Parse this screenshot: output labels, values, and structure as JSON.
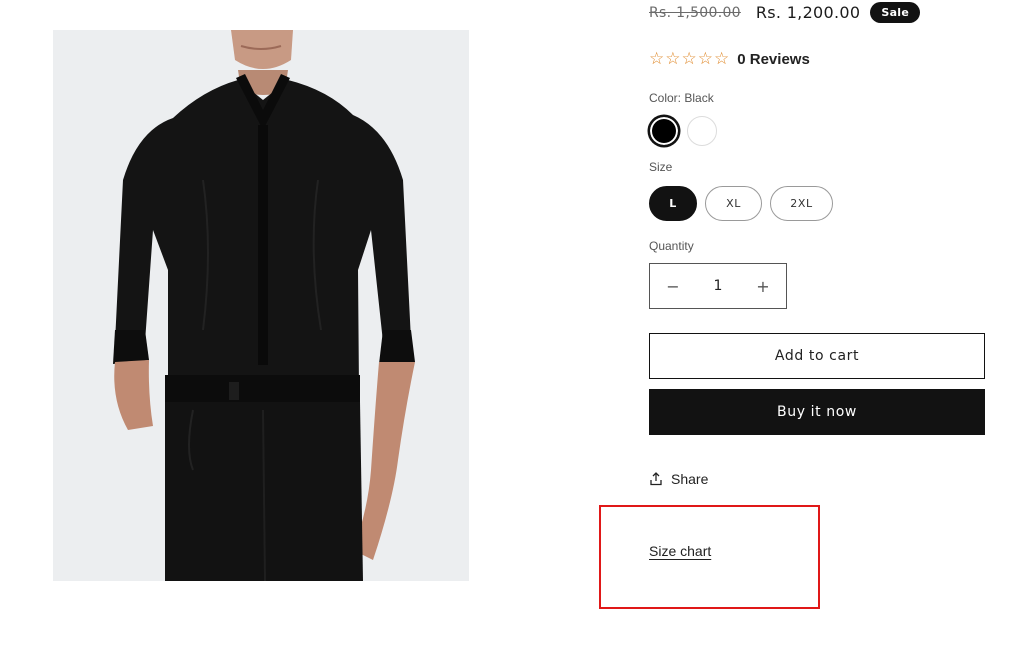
{
  "product": {
    "price_old": "Rs. 1,500.00",
    "price_new": "Rs. 1,200.00",
    "sale_badge": "Sale",
    "rating_stars": 0,
    "rating_max": 5,
    "reviews_label": "0 Reviews",
    "color_label": "Color: Black",
    "colors": [
      {
        "name": "Black",
        "hex": "#000000",
        "selected": true
      },
      {
        "name": "White",
        "hex": "#ffffff",
        "selected": false
      }
    ],
    "size_label": "Size",
    "sizes": [
      {
        "label": "L",
        "selected": true
      },
      {
        "label": "XL",
        "selected": false
      },
      {
        "label": "2XL",
        "selected": false
      }
    ],
    "quantity_label": "Quantity",
    "quantity": "1",
    "qty_minus": "−",
    "qty_plus": "+",
    "add_to_cart": "Add to cart",
    "buy_now": "Buy it now",
    "share": "Share",
    "size_chart": "Size chart"
  },
  "colors": {
    "accent": "#121212",
    "star": "#e08a2c",
    "highlight": "#e01818"
  }
}
